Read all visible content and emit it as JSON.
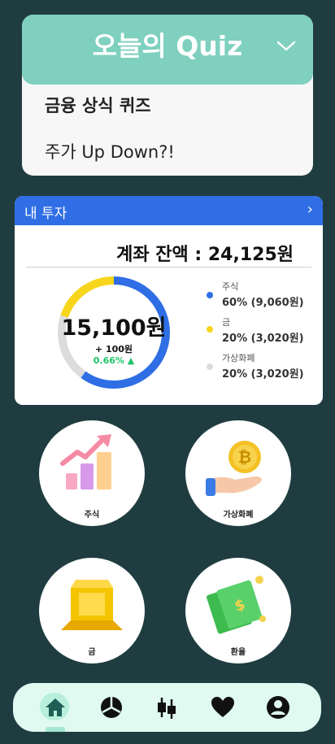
{
  "quiz": {
    "title": "오늘의 Quiz",
    "items": [
      "금융 상식 퀴즈",
      "주가 Up Down?!"
    ]
  },
  "invest": {
    "header": "내 투자",
    "balance": "계좌 잔액 : 24,125원",
    "total": "15,100원",
    "change": "+ 100원",
    "change_pct": "0.66% ▲",
    "legend": [
      {
        "name": "주식",
        "value": "60% (9,060원)",
        "color": "#2f6ee4",
        "percent": 60
      },
      {
        "name": "금",
        "value": "20% (3,020원)",
        "color": "#f7d51c",
        "percent": 20
      },
      {
        "name": "가상화폐",
        "value": "20% (3,020원)",
        "color": "#dcdcdc",
        "percent": 20
      }
    ]
  },
  "categories": [
    {
      "label": "주식",
      "icon": "stock-chart-icon"
    },
    {
      "label": "가상화폐",
      "icon": "bitcoin-coin-icon"
    },
    {
      "label": "금",
      "icon": "gold-bar-icon"
    },
    {
      "label": "환율",
      "icon": "money-bills-icon"
    }
  ],
  "nav": {
    "items": [
      "home-icon",
      "portfolio-icon",
      "candlestick-icon",
      "heart-icon",
      "profile-icon"
    ],
    "active": "home-icon"
  },
  "colors": {
    "background": "#1f3d40",
    "quiz_accent": "#7fd0be",
    "invest_accent": "#2f6ee4",
    "up": "#1fc46a"
  }
}
